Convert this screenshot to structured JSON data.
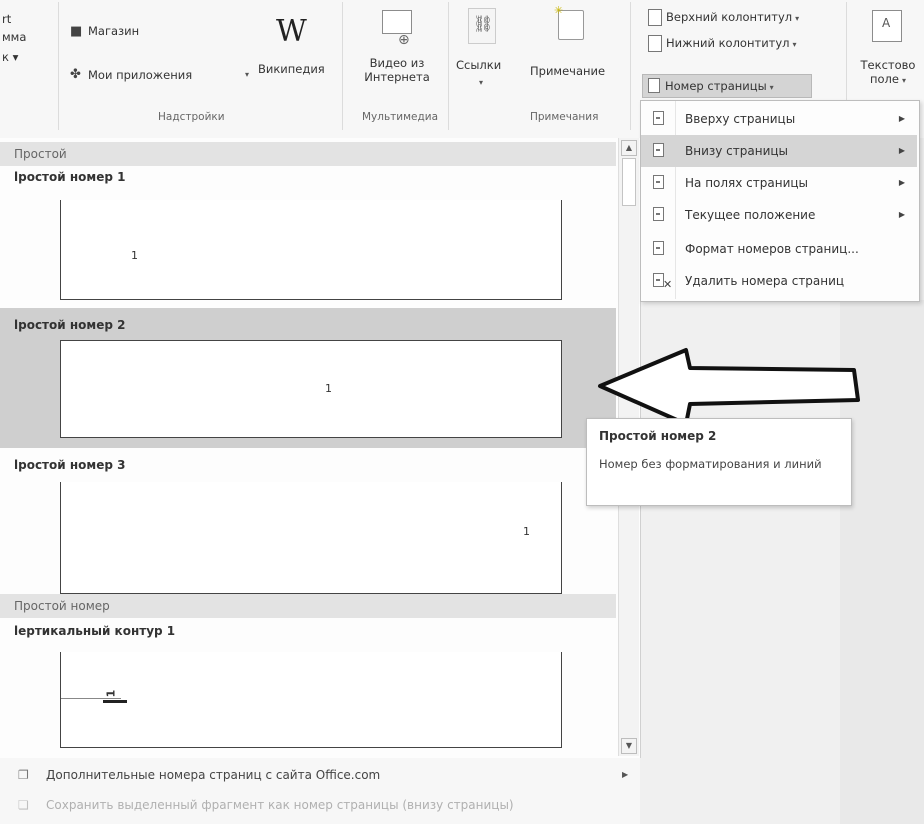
{
  "ribbon": {
    "partial_left": [
      "rt",
      "мма",
      "к ▾"
    ],
    "addins": {
      "store_label": "Магазин",
      "my_apps_label": "Мои приложения",
      "wikipedia_label": "Википедия",
      "wikipedia_glyph": "W",
      "group_label": "Надстройки"
    },
    "media": {
      "online_video_line1": "Видео из",
      "online_video_line2": "Интернета",
      "group_label": "Мультимедиа"
    },
    "links": {
      "label": "Ссылки"
    },
    "comments": {
      "comment_label": "Примечание",
      "group_label": "Примечания"
    },
    "header_footer": {
      "header_label": "Верхний колонтитул",
      "footer_label": "Нижний колонтитул",
      "page_number_label": "Номер страницы"
    },
    "textbox": {
      "line1": "Текстово",
      "line2": "поле"
    },
    "dropdown_glyph": "▾"
  },
  "gallery": {
    "sections": [
      {
        "header": "Простой"
      },
      {
        "header": "Простой номер"
      }
    ],
    "items": [
      {
        "title": "lростой номер 1",
        "number": "1"
      },
      {
        "title": "lростой номер 2",
        "number": "1"
      },
      {
        "title": "lростой номер 3",
        "number": "1"
      },
      {
        "title": "lертикальный контур 1",
        "number": "1"
      }
    ],
    "selected_index": 1
  },
  "bottom": {
    "more_numbers": "Дополнительные номера страниц с сайта Office.com",
    "save_selection": "Сохранить выделенный фрагмент как номер страницы (внизу страницы)"
  },
  "menu": {
    "items": [
      {
        "label": "Вверху страницы",
        "submenu": true
      },
      {
        "label": "Внизу страницы",
        "submenu": true
      },
      {
        "label": "На полях страницы",
        "submenu": true
      },
      {
        "label": "Текущее положение",
        "submenu": true
      },
      {
        "label": "Формат номеров страниц...",
        "submenu": false
      },
      {
        "label": "Удалить номера страниц",
        "submenu": false
      }
    ],
    "highlighted_index": 1
  },
  "tooltip": {
    "title": "Простой номер 2",
    "description": "Номер без форматирования и линий"
  },
  "colors": {
    "selected_row": "#cfcfcf",
    "section_header": "#e3e3e3",
    "menu_highlight": "#d5d5d5"
  }
}
